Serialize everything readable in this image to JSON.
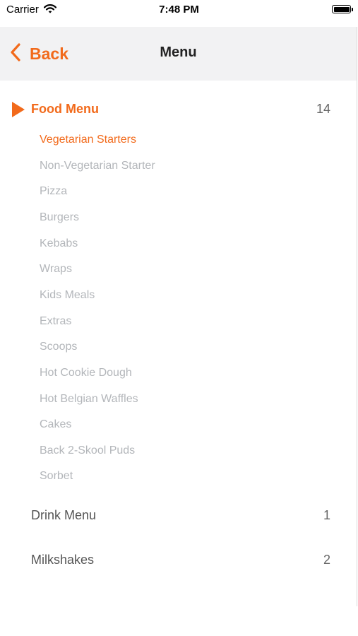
{
  "status_bar": {
    "carrier": "Carrier",
    "time": "7:48 PM"
  },
  "nav": {
    "back_label": "Back",
    "title": "Menu"
  },
  "colors": {
    "accent": "#f26a1b",
    "inactive_text": "#b3b6ba",
    "nav_background": "#f2f2f3"
  },
  "sections": [
    {
      "label": "Food Menu",
      "count": "14",
      "expanded": true,
      "items": [
        "Vegetarian Starters",
        "Non-Vegetarian Starter",
        "Pizza",
        "Burgers",
        "Kebabs",
        "Wraps",
        "Kids Meals",
        "Extras",
        "Scoops",
        "Hot Cookie Dough",
        "Hot Belgian Waffles",
        "Cakes",
        "Back 2-Skool Puds",
        "Sorbet"
      ],
      "selected_item": "Vegetarian Starters"
    },
    {
      "label": "Drink Menu",
      "count": "1",
      "expanded": false
    },
    {
      "label": "Milkshakes",
      "count": "2",
      "expanded": false
    }
  ]
}
